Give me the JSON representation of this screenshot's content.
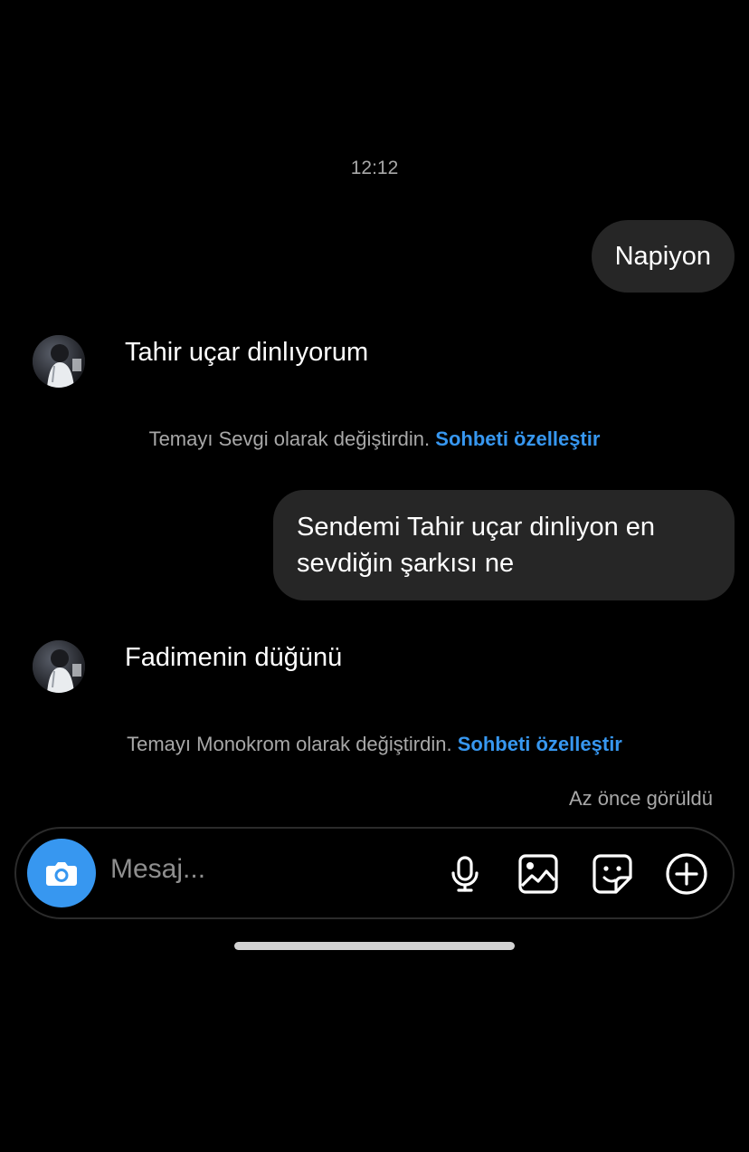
{
  "thread": {
    "timestamp": "12:12",
    "messages": [
      {
        "direction": "outgoing",
        "text": "Napiyon"
      },
      {
        "direction": "incoming",
        "text": "Tahir uçar dinlıyorum"
      },
      {
        "direction": "system",
        "text": "Temayı Sevgi olarak değiştirdin.",
        "link": "Sohbeti özelleştir"
      },
      {
        "direction": "outgoing",
        "lines": [
          "Sendemi Tahir uçar dinliyon en",
          "sevdiğin şarkısı ne"
        ]
      },
      {
        "direction": "incoming",
        "text": "Fadimenin düğünü"
      },
      {
        "direction": "system",
        "text": "Temayı Monokrom olarak değiştirdin.",
        "link": "Sohbeti özelleştir"
      }
    ],
    "seen_status": "Az önce görüldü"
  },
  "composer": {
    "placeholder": "Mesaj...",
    "icons": [
      "camera-icon",
      "microphone-icon",
      "gallery-icon",
      "sticker-icon",
      "plus-icon"
    ]
  },
  "colors": {
    "background": "#000000",
    "bubble": "#262626",
    "accent": "#3797f0",
    "muted_text": "#a8a8a8"
  }
}
